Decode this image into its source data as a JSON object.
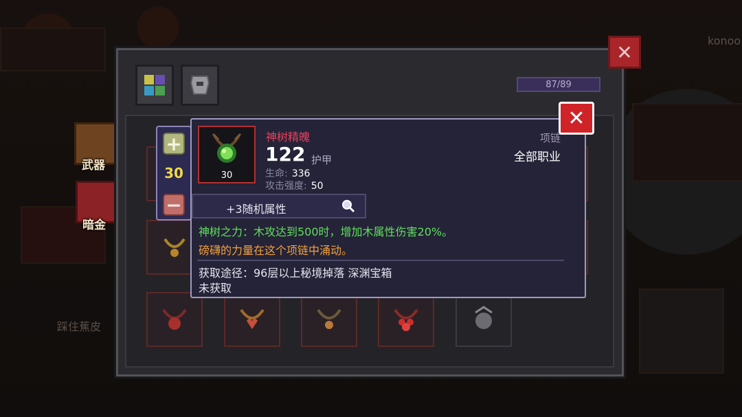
{
  "background": {
    "player_name": "konoo",
    "caption": "踩住蕉皮"
  },
  "panel": {
    "counter": "87/89"
  },
  "side_menu": [
    {
      "label": "武器"
    },
    {
      "label": "暗金"
    }
  ],
  "stepper": {
    "value": "30",
    "plus_label": "+",
    "minus_label": "−"
  },
  "item": {
    "name": "神树精魄",
    "level": "30",
    "main_stat_value": "122",
    "main_stat_label": "护甲",
    "stats": [
      {
        "label": "生命:",
        "value": "336"
      },
      {
        "label": "攻击强度:",
        "value": "50"
      }
    ],
    "slot_type": "项链",
    "class": "全部职业",
    "random_attr": "+3随机属性",
    "passive": "神树之力：木攻达到500时，增加木属性伤害20%。",
    "flavor": "磅礴的力量在这个项链中涌动。",
    "source": "获取途径：96层以上秘境掉落 深渊宝箱",
    "status": "未获取"
  },
  "colors": {
    "item_name": "#e9415a",
    "passive": "#5ee05c",
    "flavor": "#f3a03a",
    "level_number": "#f1d74a",
    "close_red": "#cf2328"
  },
  "icons": [
    "close-icon",
    "grid-icon",
    "armor-icon",
    "magnifier-icon",
    "plus-icon",
    "minus-icon",
    "necklace-icon"
  ]
}
